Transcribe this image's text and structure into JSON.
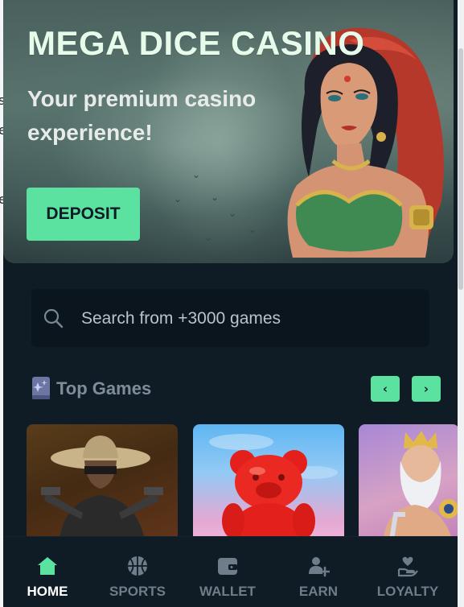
{
  "hero": {
    "title": "MEGA DICE CASINO",
    "subtitle": "Your premium casino experience!",
    "deposit_label": "DEPOSIT"
  },
  "search": {
    "placeholder": "Search from +3000 games"
  },
  "top_games": {
    "title": "Top Games",
    "prev_arrow": "‹",
    "next_arrow": "›",
    "cards": [
      {
        "icon": "gunslinger-artwork"
      },
      {
        "icon": "red-gummy-bear-artwork"
      },
      {
        "icon": "zeus-artwork"
      }
    ]
  },
  "bottom_nav": {
    "items": [
      {
        "label": "HOME",
        "icon": "home-icon",
        "active": true
      },
      {
        "label": "SPORTS",
        "icon": "basketball-icon",
        "active": false
      },
      {
        "label": "WALLET",
        "icon": "wallet-icon",
        "active": false
      },
      {
        "label": "EARN",
        "icon": "add-user-icon",
        "active": false
      },
      {
        "label": "LOYALTY",
        "icon": "heart-hand-icon",
        "active": false
      }
    ]
  },
  "colors": {
    "accent": "#5be2a0",
    "background": "#0f1c26",
    "search_bg": "#0a151e",
    "muted_text": "#6e7d89"
  }
}
